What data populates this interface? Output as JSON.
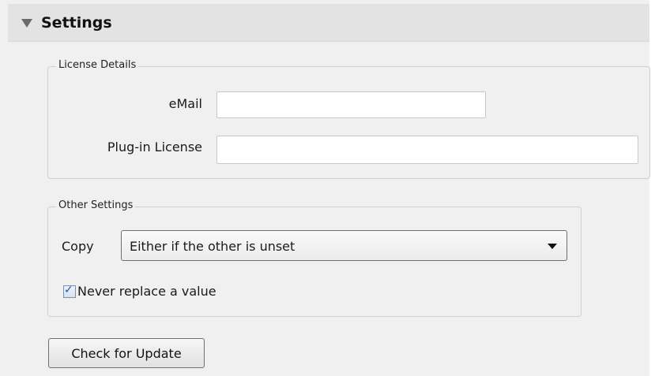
{
  "header": {
    "title": "Settings",
    "icon": "collapse-triangle-icon"
  },
  "license": {
    "legend": "License Details",
    "email_label": "eMail",
    "email_value": "",
    "license_label": "Plug-in License",
    "license_value": ""
  },
  "other": {
    "legend": "Other Settings",
    "copy_label": "Copy",
    "copy_selected": "Either if the other is unset",
    "never_replace_label": "Never replace a value",
    "never_replace_checked": true
  },
  "actions": {
    "check_update_label": "Check for Update"
  }
}
